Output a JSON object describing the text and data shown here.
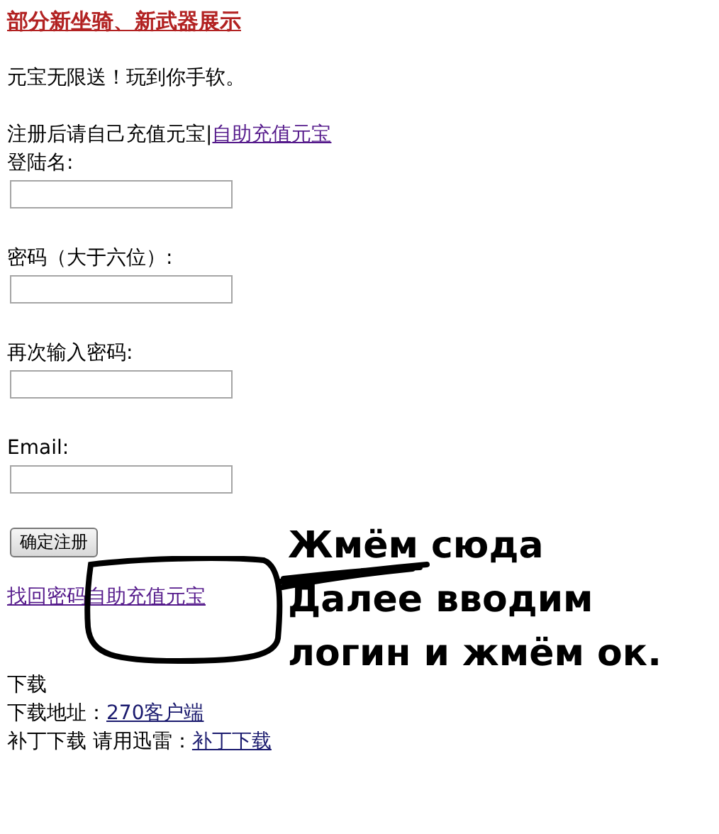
{
  "header_link": "部分新坐骑、新武器展示",
  "promo": "元宝无限送！玩到你手软。",
  "notice": {
    "text": "注册后请自己充值元宝|",
    "link": "自助充值元宝"
  },
  "fields": [
    {
      "label": "登陆名:"
    },
    {
      "label": "密码（大于六位）:"
    },
    {
      "label": "再次输入密码:"
    },
    {
      "label": "Email:"
    }
  ],
  "submit": "确定注册",
  "links": [
    "找回密码",
    "自助充值元宝"
  ],
  "downloads": {
    "heading": "下载",
    "lines": [
      {
        "text": "下载地址：",
        "link": "270客户端"
      },
      {
        "text": "补丁下载 请用迅雷：",
        "link": "补丁下载"
      }
    ]
  },
  "annotation": {
    "lines": [
      "Жмём сюда",
      "Далее вводим",
      "логин и жмём ок."
    ]
  }
}
